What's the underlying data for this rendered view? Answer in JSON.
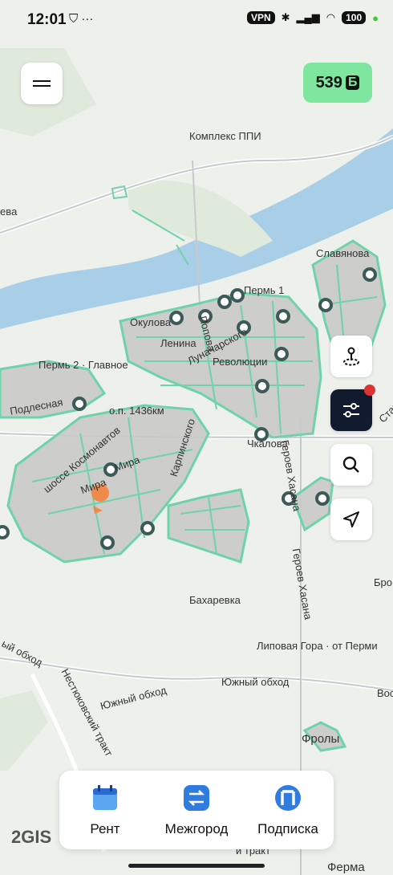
{
  "status_bar": {
    "time": "12:01",
    "icons_left": "⛉ ···",
    "vpn": "VPN",
    "battery": "100"
  },
  "balance": {
    "amount": "539",
    "currency": "Б"
  },
  "map_labels": [
    "Комплекс ППИ",
    "евa",
    "Славянова",
    "Пермь 1",
    "Окулова",
    "Попова",
    "Ленина",
    "Луначарского",
    "Революции",
    "Пермь 2 · Главное",
    "Подлесная",
    "о.п. 1436км",
    "Карпинского",
    "шоссе Космонавтов",
    "Мира",
    "Мира",
    "Чкалова",
    "Героев Хасана",
    "Героев Хасана",
    "Бахаревка",
    "Липовая Гора · от Перми",
    "Южный обход",
    "Южный обход",
    "Нестюковский тракт",
    "Фролы",
    "Ферма",
    "Бро",
    "Вос",
    "Старцева",
    "ый обход",
    "й тракт"
  ],
  "bottom_tabs": [
    {
      "label": "Рент",
      "icon": "calendar-icon"
    },
    {
      "label": "Межгород",
      "icon": "intercity-icon"
    },
    {
      "label": "Подписка",
      "icon": "subscription-icon"
    }
  ],
  "map_attribution": "2GIS",
  "colors": {
    "accent_green": "#7fe6a0",
    "zone_stroke": "#6fd3a8",
    "zone_fill": "#c9c9c9",
    "river": "#a9cfe8",
    "marker": "#f08a4b"
  }
}
